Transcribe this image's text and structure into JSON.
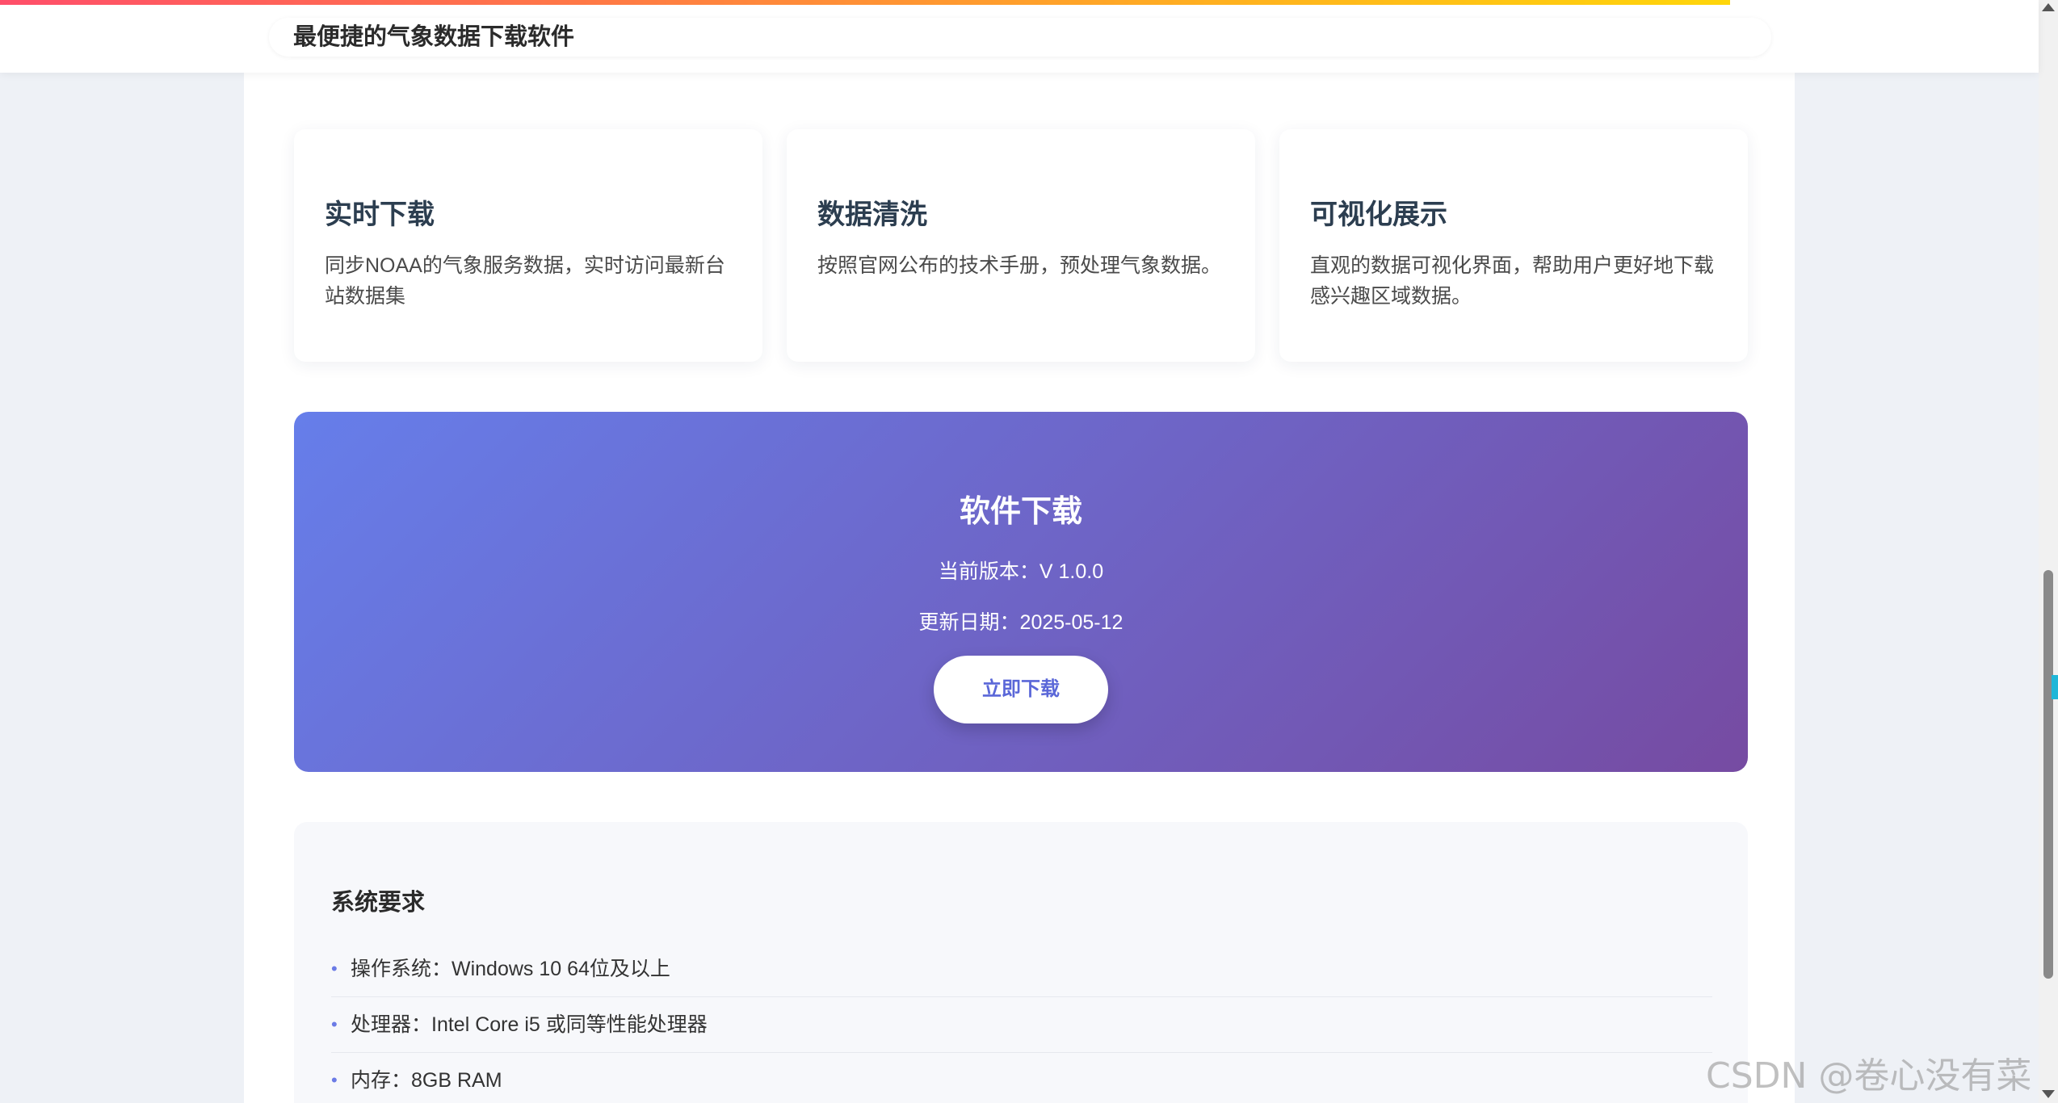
{
  "header": {
    "title": "最便捷的气象数据下载软件"
  },
  "features": [
    {
      "title": "实时下载",
      "desc": "同步NOAA的气象服务数据，实时访问最新台站数据集"
    },
    {
      "title": "数据清洗",
      "desc": "按照官网公布的技术手册，预处理气象数据。"
    },
    {
      "title": "可视化展示",
      "desc": "直观的数据可视化界面，帮助用户更好地下载感兴趣区域数据。"
    }
  ],
  "download": {
    "title": "软件下载",
    "version": "当前版本：V 1.0.0",
    "date": "更新日期：2025-05-12",
    "button_label": "立即下载"
  },
  "requirements": {
    "title": "系统要求",
    "bullet": "•",
    "items": [
      "操作系统：Windows 10 64位及以上",
      "处理器：Intel Core i5 或同等性能处理器",
      "内存：8GB RAM"
    ]
  },
  "watermark": "CSDN @卷心没有菜",
  "colors": {
    "gradient_start": "#667eea",
    "gradient_end": "#764ba2",
    "button_text": "#5a67d8",
    "bullet": "#6b7be6"
  }
}
